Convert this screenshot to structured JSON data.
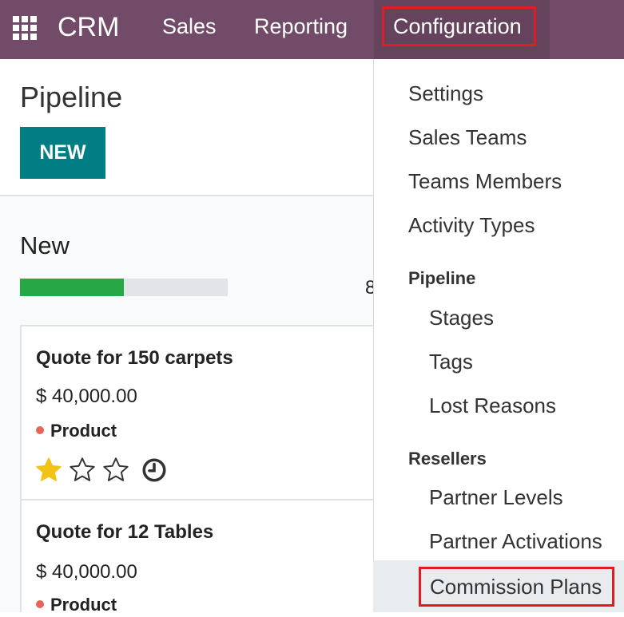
{
  "navbar": {
    "brand": "CRM",
    "menu": [
      "Sales",
      "Reporting",
      "Configuration"
    ],
    "apps_icon": "grid-apps-icon",
    "color": "#714b67"
  },
  "control_panel": {
    "title": "Pipeline",
    "new_button": "NEW"
  },
  "kanban": {
    "column_title": "New",
    "progress_fraction": 0.5,
    "count_peek": "8",
    "cards": [
      {
        "title": "Quote for 150 carpets",
        "amount": "$ 40,000.00",
        "tag": "Product",
        "priority_stars_filled": 1,
        "priority_stars_total": 3
      },
      {
        "title": "Quote for 12 Tables",
        "amount": "$ 40,000.00",
        "tag": "Product"
      }
    ]
  },
  "dropdown": {
    "items": [
      "Settings",
      "Sales Teams",
      "Teams Members",
      "Activity Types"
    ],
    "pipeline_header": "Pipeline",
    "pipeline_items": [
      "Stages",
      "Tags",
      "Lost Reasons"
    ],
    "resellers_header": "Resellers",
    "resellers_items": [
      "Partner Levels",
      "Partner Activations",
      "Commission Plans"
    ]
  },
  "colors": {
    "accent": "#714b67",
    "primary_button": "#017e84",
    "highlight_border": "#e01b24",
    "progress": "#28a745",
    "star": "#f3c314",
    "tag_dot": "#e8645a"
  }
}
